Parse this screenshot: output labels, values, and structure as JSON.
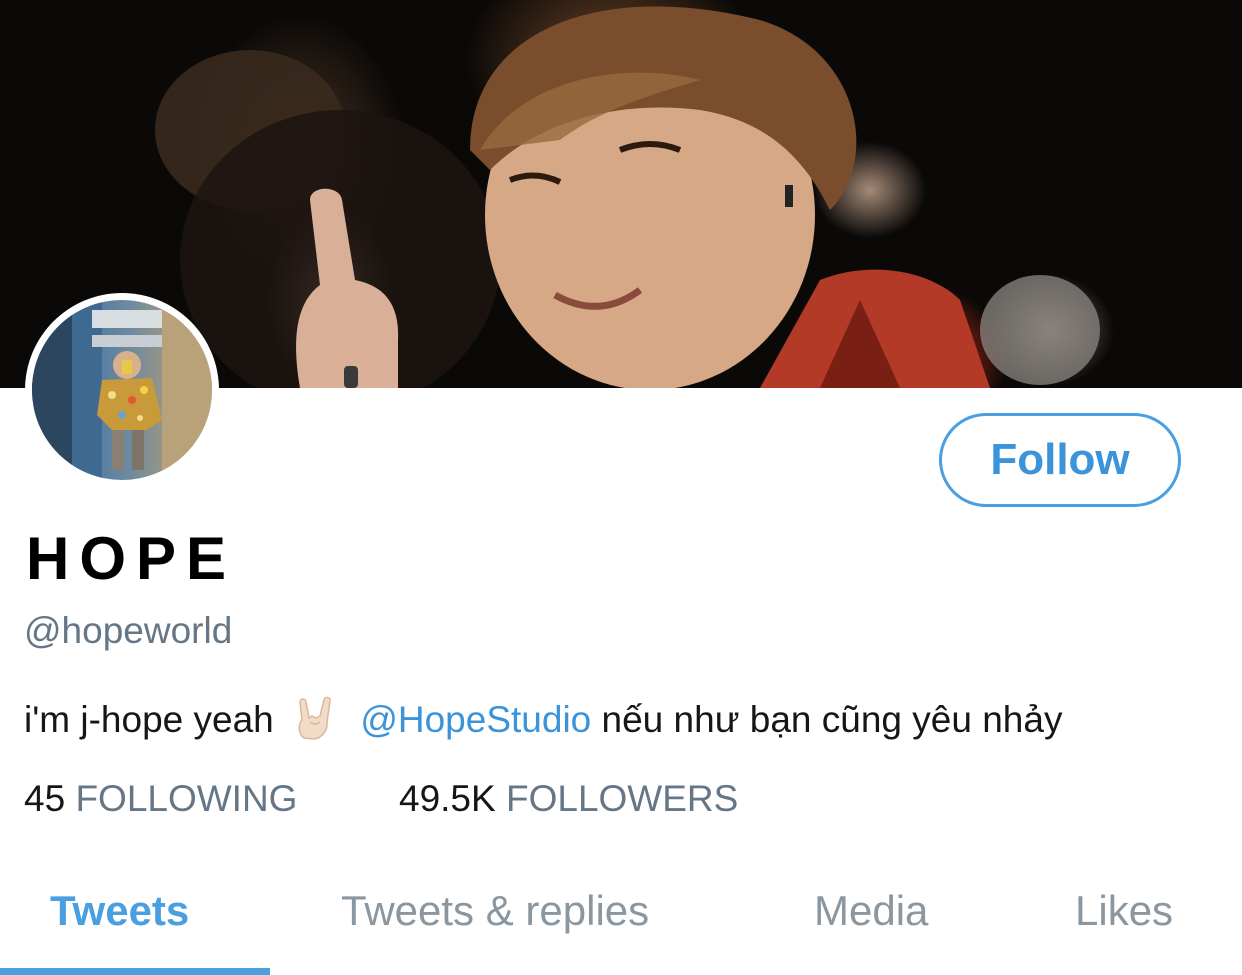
{
  "profile": {
    "display_name": "HOPE",
    "handle": "@hopeworld",
    "bio": {
      "prefix": "i'm j-hope yeah",
      "emoji": "sign-of-the-horns-emoji",
      "mention": "@HopeStudio",
      "suffix": "nếu như bạn cũng yêu nhảy"
    }
  },
  "follow_button": {
    "label": "Follow"
  },
  "stats": {
    "following_count": "45",
    "following_label": "FOLLOWING",
    "followers_count": "49.5K",
    "followers_label": "FOLLOWERS"
  },
  "tabs": [
    {
      "label": "Tweets",
      "active": true
    },
    {
      "label": "Tweets & replies",
      "active": false
    },
    {
      "label": "Media",
      "active": false
    },
    {
      "label": "Likes",
      "active": false
    }
  ],
  "colors": {
    "accent": "#4a9fe0",
    "secondary_text": "#657786",
    "primary_text": "#14171a"
  }
}
